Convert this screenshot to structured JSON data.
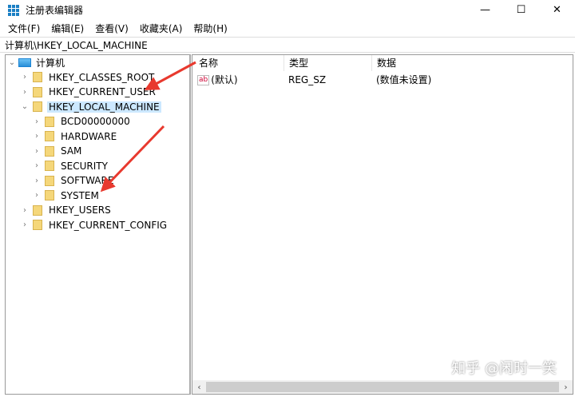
{
  "window": {
    "title": "注册表编辑器",
    "minimize": "—",
    "maximize": "☐",
    "close": "✕"
  },
  "menu": [
    "文件(F)",
    "编辑(E)",
    "查看(V)",
    "收藏夹(A)",
    "帮助(H)"
  ],
  "address": "计算机\\HKEY_LOCAL_MACHINE",
  "tree": {
    "root": "计算机",
    "items": [
      "HKEY_CLASSES_ROOT",
      "HKEY_CURRENT_USER",
      "HKEY_LOCAL_MACHINE",
      "BCD00000000",
      "HARDWARE",
      "SAM",
      "SECURITY",
      "SOFTWARE",
      "SYSTEM",
      "HKEY_USERS",
      "HKEY_CURRENT_CONFIG"
    ],
    "selected": "HKEY_LOCAL_MACHINE"
  },
  "list": {
    "columns": [
      "名称",
      "类型",
      "数据"
    ],
    "rows": [
      {
        "name": "(默认)",
        "type": "REG_SZ",
        "data": "(数值未设置)",
        "icon": "ab"
      }
    ]
  },
  "watermark": "知乎 @闲时一笑",
  "colors": {
    "arrow": "#e8392e",
    "selection": "#cce8ff"
  }
}
